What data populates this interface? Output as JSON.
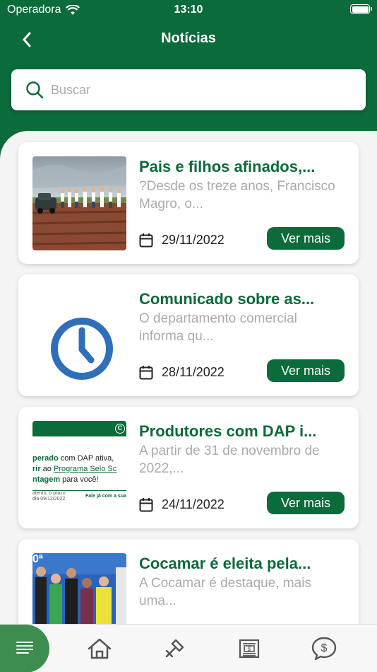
{
  "status_bar": {
    "carrier": "Operadora",
    "time": "13:10"
  },
  "header": {
    "title": "Notícias"
  },
  "search": {
    "placeholder": "Buscar"
  },
  "colors": {
    "primary": "#0b6b3a",
    "active_tab": "#3e8d50",
    "excerpt": "#aaaaaa"
  },
  "news": [
    {
      "title": "Pais e filhos afinados,...",
      "excerpt": "?Desde os treze anos, Francisco Magro, o...",
      "date": "29/11/2022",
      "button": "Ver mais",
      "thumb": "photo-field-group"
    },
    {
      "title": "Comunicado sobre as...",
      "excerpt": "O departamento comercial informa qu...",
      "date": "28/11/2022",
      "button": "Ver mais",
      "thumb": "clock-icon"
    },
    {
      "title": "Produtores com DAP i...",
      "excerpt": "A partir de 31 de novembro de 2022,...",
      "date": "24/11/2022",
      "button": "Ver mais",
      "thumb": "promo-banner",
      "thumb_text": {
        "line1_bold": "perado",
        "line1_rest": " com DAP ativa,",
        "line2_bold": "rir",
        "line2_mid": " ao ",
        "line2_link": "Programa Selo Sc",
        "line3_bold": "ntagem",
        "line3_rest": " para você!",
        "small1": "atento, o prazo",
        "small2": "dia 09/12/2022.",
        "cta": "Fale já com a sua",
        "logo": "C"
      }
    },
    {
      "title": "Cocamar é eleita pela...",
      "excerpt": "A Cocamar é destaque, mais uma...",
      "date": "",
      "button": "",
      "thumb": "photo-award-group",
      "thumb_text": {
        "corner": "0ª"
      }
    }
  ],
  "tabbar": {
    "items": [
      {
        "name": "news-list-icon",
        "active": true
      },
      {
        "name": "home-icon",
        "active": false
      },
      {
        "name": "tools-icon",
        "active": false
      },
      {
        "name": "newspaper-icon",
        "active": false
      },
      {
        "name": "money-chat-icon",
        "active": false
      }
    ]
  }
}
